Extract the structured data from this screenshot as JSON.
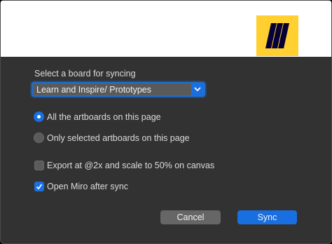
{
  "dialog": {
    "board_label": "Select a board for syncing",
    "board_select": {
      "value": "Learn and Inspire/ Prototypes"
    },
    "scope_options": [
      {
        "label": "All the artboards on this page",
        "selected": true
      },
      {
        "label": "Only selected artboards on this page",
        "selected": false
      }
    ],
    "checkboxes": [
      {
        "label": "Export at @2x and scale to 50% on canvas",
        "checked": false
      },
      {
        "label": "Open Miro after sync",
        "checked": true
      }
    ],
    "buttons": {
      "cancel": "Cancel",
      "sync": "Sync"
    }
  },
  "colors": {
    "background": "#323232",
    "accent": "#1a6fe0",
    "logo_bg": "#ffd02f",
    "banner": "#ffffff"
  },
  "icons": [
    "miro-logo-icon",
    "chevron-down-icon",
    "checkmark-icon"
  ]
}
